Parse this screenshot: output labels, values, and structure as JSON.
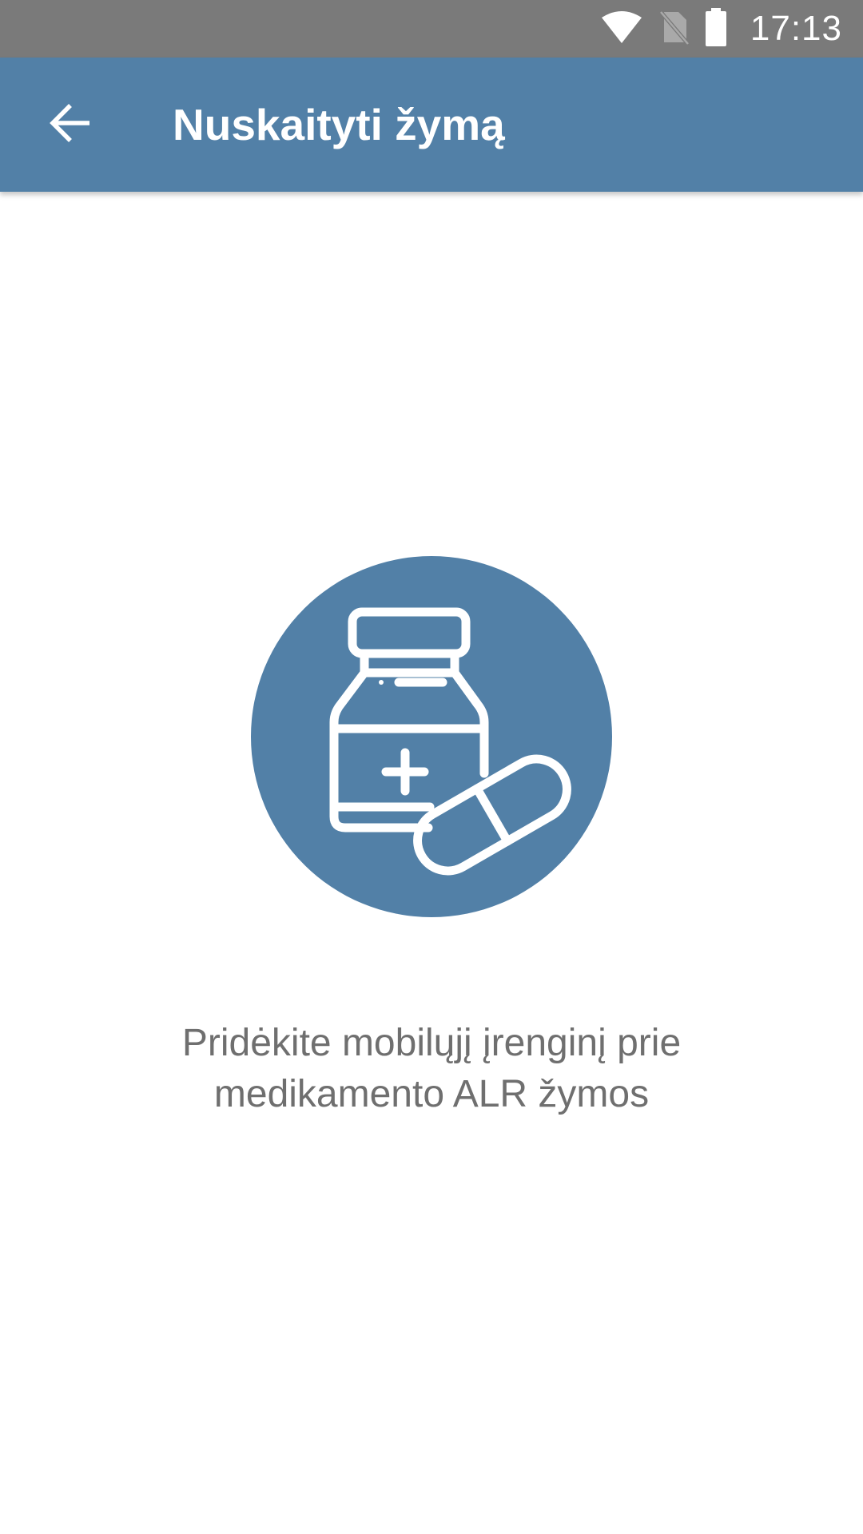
{
  "status_bar": {
    "time": "17:13",
    "icons": [
      "wifi-icon",
      "no-sim-icon",
      "battery-icon"
    ]
  },
  "app_bar": {
    "back_icon": "arrow-left-icon",
    "title": "Nuskaityti žymą"
  },
  "main": {
    "illustration_icon": "medicine-bottle-pill-icon",
    "instruction": "Pridėkite mobilųjį įrenginį prie medikamento ALR žymos"
  },
  "colors": {
    "status_bar": "#7a7a7a",
    "app_bar": "#5280a7",
    "illustration_circle": "#5280a7",
    "instruction_text": "#6f6f6f"
  }
}
